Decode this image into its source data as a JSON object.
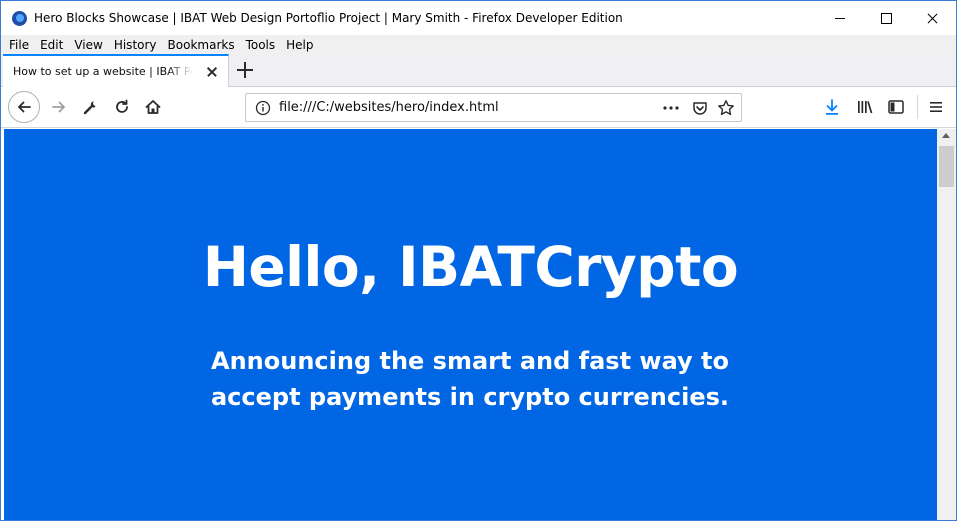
{
  "window": {
    "title": "Hero Blocks Showcase | IBAT Web Design Portoflio Project | Mary Smith - Firefox Developer Edition"
  },
  "menu": [
    {
      "accel": "F",
      "rest": "ile"
    },
    {
      "accel": "E",
      "rest": "dit"
    },
    {
      "accel": "V",
      "rest": "iew"
    },
    {
      "accel": "",
      "pre": "Hi",
      "accel2": "s",
      "rest": "tory"
    },
    {
      "accel": "B",
      "rest": "ookmarks"
    },
    {
      "accel": "T",
      "rest": "ools"
    },
    {
      "accel": "H",
      "rest": "elp"
    }
  ],
  "menu_labels": [
    "File",
    "Edit",
    "View",
    "History",
    "Bookmarks",
    "Tools",
    "Help"
  ],
  "tabs": [
    {
      "title": "How to set up a website | IBAT Portfolio"
    }
  ],
  "toolbar": {
    "url": "file:///C:/websites/hero/index.html",
    "icons": [
      "back-icon",
      "forward-icon",
      "wrench-icon",
      "reload-icon",
      "home-icon",
      "info-icon",
      "more-icon",
      "pocket-icon",
      "bookmark-star-icon",
      "download-icon",
      "library-icon",
      "sidebar-icon",
      "hamburger-menu-icon"
    ]
  },
  "page": {
    "hero_title": "Hello, IBATCrypto",
    "hero_subtitle": "Announcing the smart and fast way to accept payments in crypto currencies."
  },
  "colors": {
    "hero_background": "#0066e4",
    "hero_text": "#ffffff",
    "accent": "#0a84ff"
  }
}
